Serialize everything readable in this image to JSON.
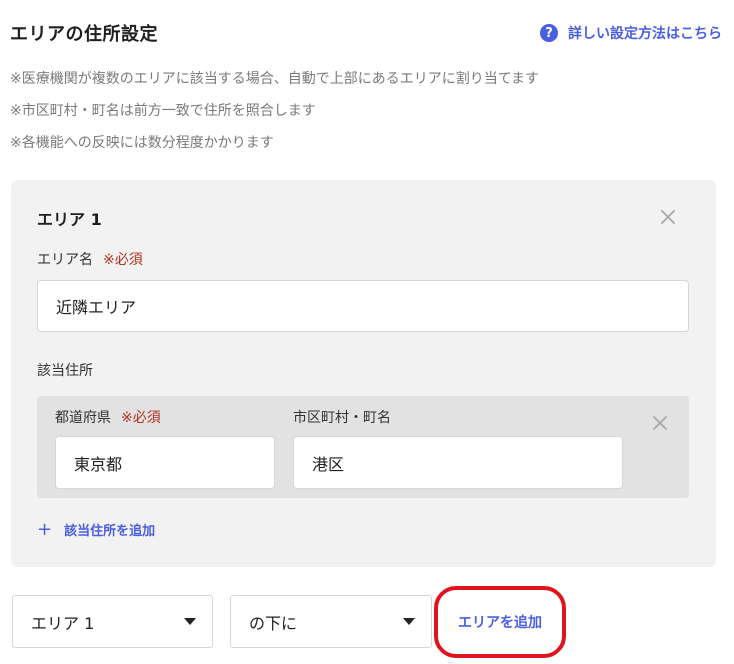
{
  "header": {
    "title": "エリアの住所設定",
    "help_icon": "question-circle-icon",
    "help_label": "詳しい設定方法はこちら"
  },
  "notes": [
    "※医療機関が複数のエリアに該当する場合、自動で上部にあるエリアに割り当てます",
    "※市区町村・町名は前方一致で住所を照合します",
    "※各機能への反映には数分程度かかります"
  ],
  "area_card": {
    "title": "エリア 1",
    "close_icon": "close-icon",
    "name_label": "エリア名",
    "required_label": "※必須",
    "name_value": "近隣エリア",
    "address_section_label": "該当住所",
    "address_row": {
      "prefecture_label": "都道府県",
      "prefecture_required": "※必須",
      "prefecture_value": "東京都",
      "city_label": "市区町村・町名",
      "city_value": "港区"
    },
    "add_address_icon": "plus-icon",
    "add_address_label": "該当住所を追加"
  },
  "footer": {
    "area_select_value": "エリア 1",
    "position_select_value": "の下に",
    "add_area_label": "エリアを追加"
  },
  "colors": {
    "accent": "#4a5ee0",
    "required": "#b0321e",
    "highlight_ring": "#e0141e"
  }
}
